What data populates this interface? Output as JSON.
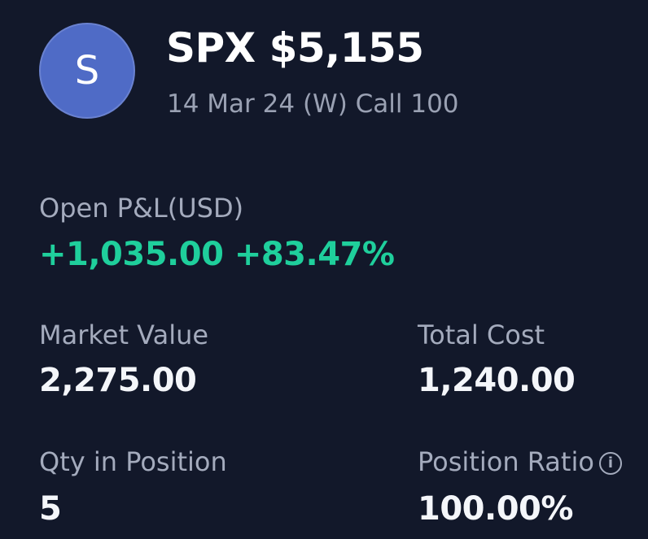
{
  "header": {
    "avatar_letter": "S",
    "symbol_price": "SPX $5,155",
    "contract": "14 Mar 24 (W) Call 100"
  },
  "open_pnl": {
    "label": "Open P&L(USD)",
    "value": "+1,035.00 +83.47%"
  },
  "market_value": {
    "label": "Market Value",
    "value": "2,275.00"
  },
  "total_cost": {
    "label": "Total Cost",
    "value": "1,240.00"
  },
  "qty": {
    "label": "Qty in Position",
    "value": "5"
  },
  "position_ratio": {
    "label": "Position Ratio",
    "value": "100.00%",
    "info_icon": "info-icon"
  },
  "colors": {
    "background": "#12182a",
    "avatar": "#4f6bc6",
    "pnl_positive": "#1fcf9c",
    "label": "#a4abbd"
  }
}
